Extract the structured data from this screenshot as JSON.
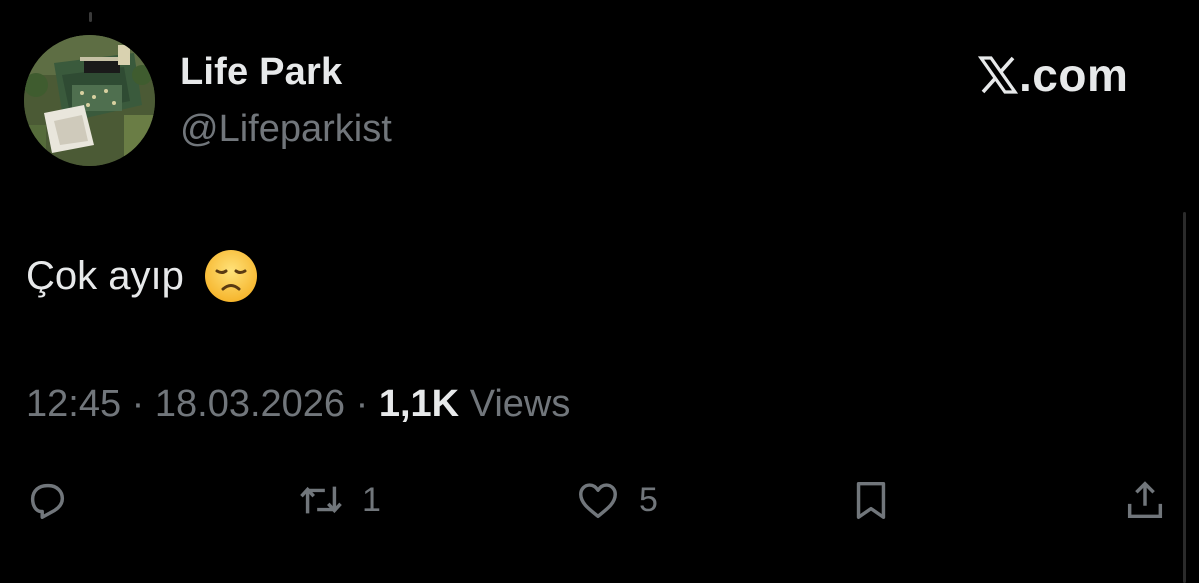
{
  "author": {
    "display_name": "Life Park",
    "handle": "@Lifeparkist"
  },
  "brand": {
    "text": ".com",
    "logo_icon": "x-logo-icon"
  },
  "tweet": {
    "text": "Çok ayıp",
    "emoji": "disappointed-face-emoji"
  },
  "meta": {
    "time": "12:45",
    "separator": "·",
    "date": "18.03.2026",
    "views_count": "1,1K",
    "views_label": "Views"
  },
  "actions": {
    "reply": {
      "icon": "reply-icon",
      "count": ""
    },
    "retweet": {
      "icon": "retweet-icon",
      "count": "1"
    },
    "like": {
      "icon": "heart-icon",
      "count": "5"
    },
    "bookmark": {
      "icon": "bookmark-icon",
      "count": ""
    },
    "share": {
      "icon": "share-icon",
      "count": ""
    }
  },
  "colors": {
    "background": "#000000",
    "primary_text": "#e7e9ea",
    "secondary_text": "#71767b"
  }
}
